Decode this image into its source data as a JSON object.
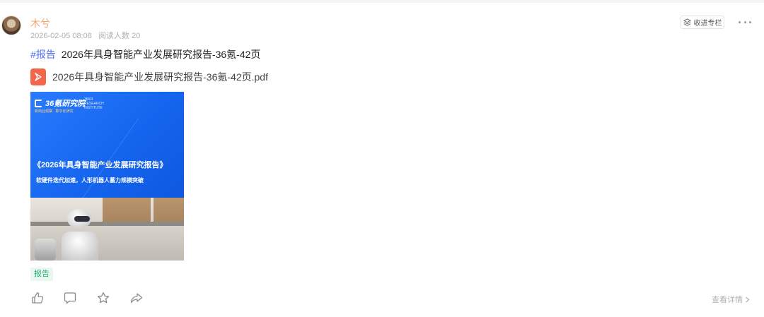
{
  "post": {
    "author": "木兮",
    "date": "2026-02-05 08:08",
    "reads": "阅读人数 20",
    "collect_label": "收进专栏",
    "hashtag": "#报告",
    "title": "2026年具身智能产业发展研究报告-36氪-42页",
    "file_name": "2026年具身智能产业发展研究报告-36氪-42页.pdf",
    "tag": "报告",
    "view_detail": "查看详情"
  },
  "cover": {
    "brand": "36氪研究院",
    "brand_en": "36KR RESEARCH INSTITUTE",
    "brand_tag": "新商业观察 · 数字化研究",
    "title": "《2026年具身智能产业发展研究报告》",
    "subtitle": "软硬件迭代加速，人形机器人蓄力规模突破"
  },
  "icons": {
    "collect": "layers-icon",
    "more": "more-dots-icon",
    "pdf": "pdf-file-icon",
    "like": "thumbs-up-icon",
    "comment": "comment-icon",
    "favorite": "star-icon",
    "share": "share-icon",
    "chevron": "chevron-right-icon"
  },
  "colors": {
    "author": "#f5a46b",
    "hashtag": "#4e6ef2",
    "pdf": "#f4664a",
    "tag_text": "#2eae74",
    "cover_blue": "#1f6bf0"
  }
}
